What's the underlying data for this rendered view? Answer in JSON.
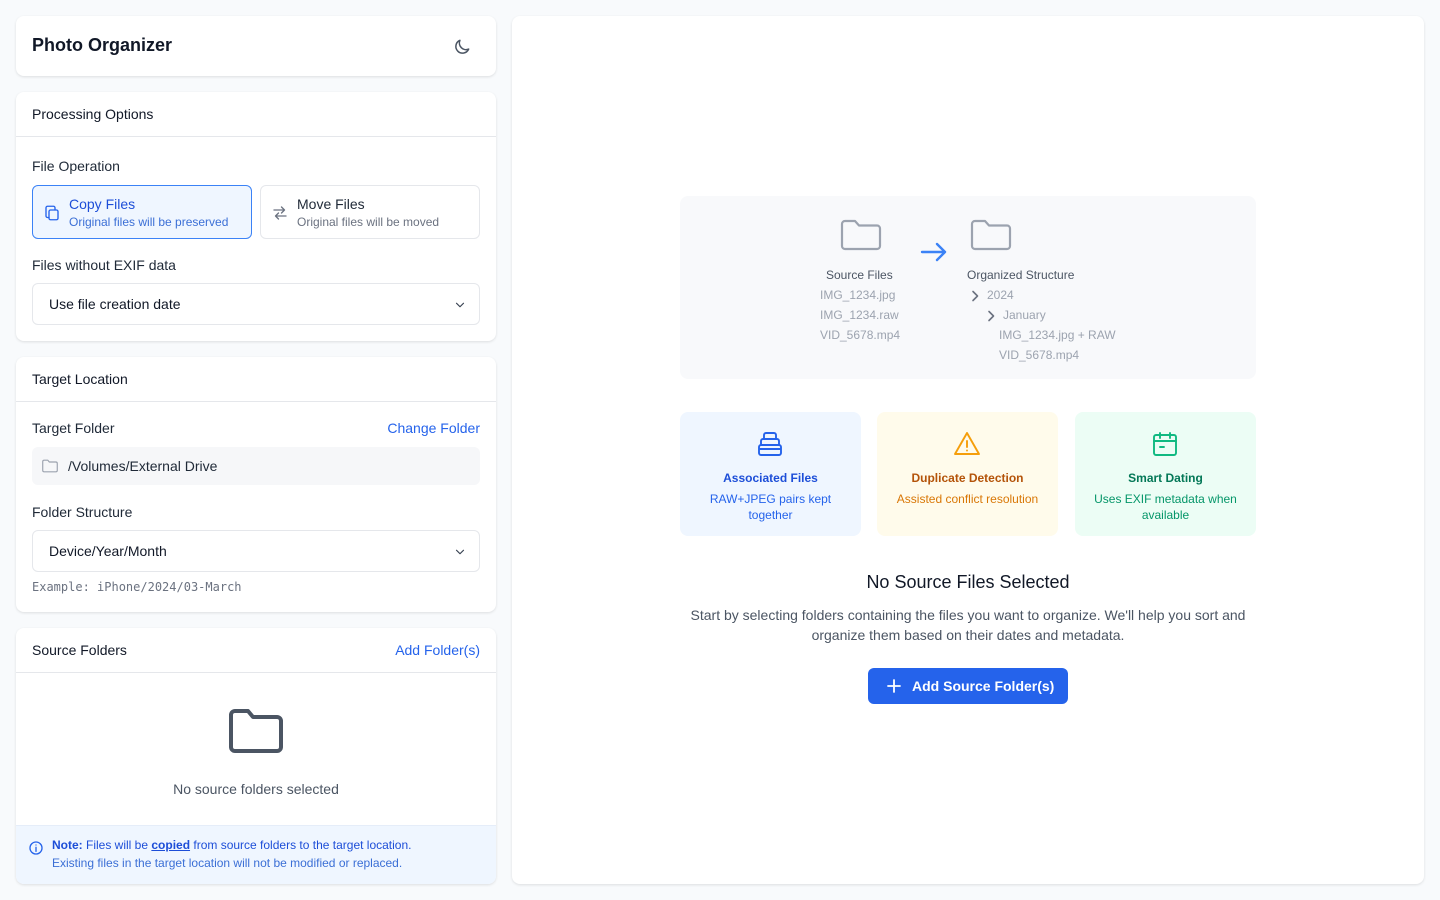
{
  "header": {
    "title": "Photo Organizer",
    "theme_icon": "moon-icon"
  },
  "processing": {
    "title": "Processing Options",
    "file_operation_label": "File Operation",
    "copy": {
      "title": "Copy Files",
      "desc": "Original files will be preserved",
      "selected": true,
      "icon": "copy-icon"
    },
    "move": {
      "title": "Move Files",
      "desc": "Original files will be moved",
      "selected": false,
      "icon": "swap-arrows-icon"
    },
    "exif_label": "Files without EXIF data",
    "exif_value": "Use file creation date"
  },
  "target": {
    "title": "Target Location",
    "folder_label": "Target Folder",
    "change_link": "Change Folder",
    "path": "/Volumes/External Drive",
    "structure_label": "Folder Structure",
    "structure_value": "Device/Year/Month",
    "example": "Example: iPhone/2024/03-March"
  },
  "source": {
    "title": "Source Folders",
    "add_link": "Add Folder(s)",
    "empty_text": "No source folders selected",
    "note_prefix": "Note:",
    "note_mid1": " Files will be ",
    "note_emph": "copied",
    "note_mid2": " from source folders to the target location.",
    "note_line2": "Existing files in the target location will not be modified or replaced."
  },
  "preview": {
    "source_title": "Source Files",
    "source_files": [
      "IMG_1234.jpg",
      "IMG_1234.raw",
      "VID_5678.mp4"
    ],
    "target_title": "Organized Structure",
    "year": "2024",
    "month": "January",
    "target_files": [
      "IMG_1234.jpg + RAW",
      "VID_5678.mp4"
    ]
  },
  "features": [
    {
      "title": "Associated Files",
      "desc": "RAW+JPEG pairs kept together",
      "icon": "stack-icon",
      "color": "#2563eb"
    },
    {
      "title": "Duplicate Detection",
      "desc": "Assisted conflict resolution",
      "icon": "warning-icon",
      "color": "#f59e0b"
    },
    {
      "title": "Smart Dating",
      "desc": "Uses EXIF metadata when available",
      "icon": "calendar-icon",
      "color": "#10b981"
    }
  ],
  "main": {
    "empty_title": "No Source Files Selected",
    "empty_desc": "Start by selecting folders containing the files you want to organize. We'll help you sort and organize them based on their dates and metadata.",
    "add_button": "Add Source Folder(s)"
  },
  "colors": {
    "accent": "#2563eb",
    "background": "#f8fafc"
  }
}
